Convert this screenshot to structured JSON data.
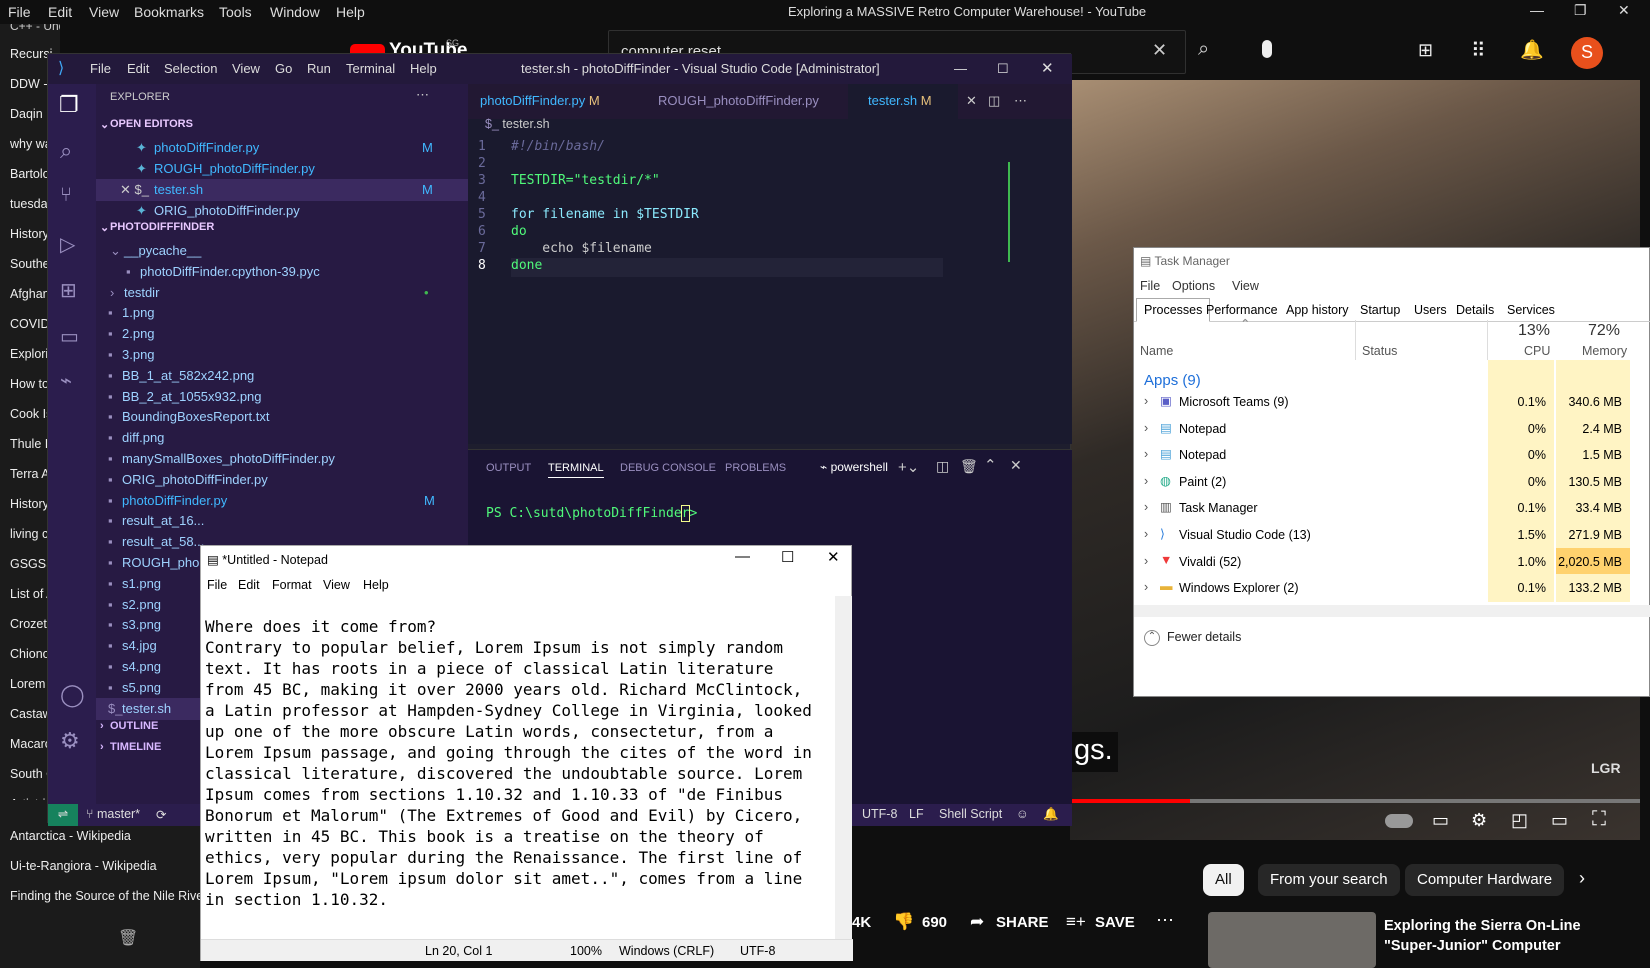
{
  "browser": {
    "menu": [
      "File",
      "Edit",
      "View",
      "Bookmarks",
      "Tools",
      "Window",
      "Help"
    ],
    "window_title": "Exploring a MASSIVE Retro Computer Warehouse! - YouTube",
    "bookmark_top": "C++ - Understanding Recursion to generate pe",
    "bookmarks": [
      "Recursi",
      "DDW -",
      "Daqin",
      "why wa",
      "Bartolo",
      "tuesday",
      "History",
      "Southe",
      "Afghan",
      "COVID-",
      "Explori",
      "How to",
      "Cook Is",
      "Thule Is",
      "Terra A",
      "History",
      "living c",
      "GSGSSI",
      "List of A",
      "Crozet",
      "Chiono",
      "Lorem",
      "Castaw",
      "Macaro",
      "South C",
      "Artist-i"
    ],
    "bookmarks_lower": [
      "Antarctica - Wikipedia",
      "Ui-te-Rangiora - Wikipedia",
      "Finding the Source of the Nile River"
    ]
  },
  "youtube": {
    "logo": "YouTube",
    "logo_sup": "SG",
    "search_value": "computer reset",
    "avatar_letter": "S",
    "caption": "gs.",
    "watermark": "LGR",
    "likes_partial": "4K",
    "dislikes": "690",
    "share": "SHARE",
    "save": "SAVE",
    "chips": [
      "All",
      "From your search",
      "Computer Hardware"
    ],
    "next_video_title": "Exploring the Sierra On-Line \"Super-Junior\" Computer",
    "accent": "#ff0000"
  },
  "vscode": {
    "menu": [
      "File",
      "Edit",
      "Selection",
      "View",
      "Go",
      "Run",
      "Terminal",
      "Help"
    ],
    "title": "tester.sh - photoDiffFinder - Visual Studio Code [Administrator]",
    "explorer_header": "EXPLORER",
    "open_editors_header": "OPEN EDITORS",
    "open_editors": [
      {
        "name": "photoDiffFinder.py",
        "badge": "M"
      },
      {
        "name": "ROUGH_photoDiffFinder.py",
        "badge": ""
      },
      {
        "name": "tester.sh",
        "badge": "M"
      },
      {
        "name": "ORIG_photoDiffFinder.py",
        "badge": ""
      }
    ],
    "project_header": "PHOTODIFFFINDER",
    "files": [
      {
        "name": "__pycache__",
        "badge": ""
      },
      {
        "name": "photoDiffFinder.cpython-39.pyc",
        "badge": ""
      },
      {
        "name": "testdir",
        "badge": "•"
      },
      {
        "name": "1.png",
        "badge": ""
      },
      {
        "name": "2.png",
        "badge": ""
      },
      {
        "name": "3.png",
        "badge": ""
      },
      {
        "name": "BB_1_at_582x242.png",
        "badge": ""
      },
      {
        "name": "BB_2_at_1055x932.png",
        "badge": ""
      },
      {
        "name": "BoundingBoxesReport.txt",
        "badge": ""
      },
      {
        "name": "diff.png",
        "badge": ""
      },
      {
        "name": "manySmallBoxes_photoDiffFinder.py",
        "badge": ""
      },
      {
        "name": "ORIG_photoDiffFinder.py",
        "badge": ""
      },
      {
        "name": "photoDiffFinder.py",
        "badge": "M"
      },
      {
        "name": "result_at_16...",
        "badge": ""
      },
      {
        "name": "result_at_58...",
        "badge": ""
      },
      {
        "name": "ROUGH_pho...",
        "badge": ""
      },
      {
        "name": "s1.png",
        "badge": ""
      },
      {
        "name": "s2.png",
        "badge": ""
      },
      {
        "name": "s3.png",
        "badge": ""
      },
      {
        "name": "s4.jpg",
        "badge": ""
      },
      {
        "name": "s4.png",
        "badge": ""
      },
      {
        "name": "s5.png",
        "badge": ""
      },
      {
        "name": "tester.sh",
        "badge": ""
      }
    ],
    "outline": "OUTLINE",
    "timeline": "TIMELINE",
    "tabs": [
      {
        "name": "photoDiffFinder.py",
        "badge": "M"
      },
      {
        "name": "ROUGH_photoDiffFinder.py",
        "badge": ""
      },
      {
        "name": "tester.sh",
        "badge": "M"
      }
    ],
    "breadcrumb": "tester.sh",
    "code": [
      "#!/bin/bash/",
      "",
      "TESTDIR=\"testdir/*\"",
      "",
      "for filename in $TESTDIR",
      "do",
      "    echo $filename",
      "done"
    ],
    "panel_tabs": [
      "OUTPUT",
      "TERMINAL",
      "DEBUG CONSOLE",
      "PROBLEMS"
    ],
    "shell": "powershell",
    "prompt": "PS C:\\sutd\\photoDiffFinder> ",
    "status": {
      "branch": "master*",
      "encoding": "UTF-8",
      "eol": "LF",
      "language": "Shell Script"
    }
  },
  "taskmgr": {
    "title": "Task Manager",
    "menu": [
      "File",
      "Options",
      "View"
    ],
    "tabs": [
      "Processes",
      "Performance",
      "App history",
      "Startup",
      "Users",
      "Details",
      "Services"
    ],
    "cols": {
      "name": "Name",
      "status": "Status",
      "cpu_pct": "13%",
      "cpu": "CPU",
      "mem_pct": "72%",
      "mem": "Memory"
    },
    "group": "Apps (9)",
    "rows": [
      {
        "name": "Microsoft Teams (9)",
        "cpu": "0.1%",
        "mem": "340.6 MB"
      },
      {
        "name": "Notepad",
        "cpu": "0%",
        "mem": "2.4 MB"
      },
      {
        "name": "Notepad",
        "cpu": "0%",
        "mem": "1.5 MB"
      },
      {
        "name": "Paint (2)",
        "cpu": "0%",
        "mem": "130.5 MB"
      },
      {
        "name": "Task Manager",
        "cpu": "0.1%",
        "mem": "33.4 MB"
      },
      {
        "name": "Visual Studio Code (13)",
        "cpu": "1.5%",
        "mem": "271.9 MB"
      },
      {
        "name": "Vivaldi (52)",
        "cpu": "1.0%",
        "mem": "2,020.5 MB"
      },
      {
        "name": "Windows Explorer (2)",
        "cpu": "0.1%",
        "mem": "133.2 MB"
      }
    ],
    "fewer": "Fewer details"
  },
  "notepad": {
    "title": "*Untitled - Notepad",
    "menu": [
      "File",
      "Edit",
      "Format",
      "View",
      "Help"
    ],
    "text": "Where does it come from?\nContrary to popular belief, Lorem Ipsum is not simply random\ntext. It has roots in a piece of classical Latin literature\nfrom 45 BC, making it over 2000 years old. Richard McClintock,\na Latin professor at Hampden-Sydney College in Virginia, looked\nup one of the more obscure Latin words, consectetur, from a\nLorem Ipsum passage, and going through the cites of the word in\nclassical literature, discovered the undoubtable source. Lorem\nIpsum comes from sections 1.10.32 and 1.10.33 of \"de Finibus\nBonorum et Malorum\" (The Extremes of Good and Evil) by Cicero,\nwritten in 45 BC. This book is a treatise on the theory of\nethics, very popular during the Renaissance. The first line of\nLorem Ipsum, \"Lorem ipsum dolor sit amet..\", comes from a line\nin section 1.10.32.",
    "status": {
      "pos": "Ln 20, Col 1",
      "zoom": "100%",
      "eol": "Windows (CRLF)",
      "enc": "UTF-8"
    }
  }
}
